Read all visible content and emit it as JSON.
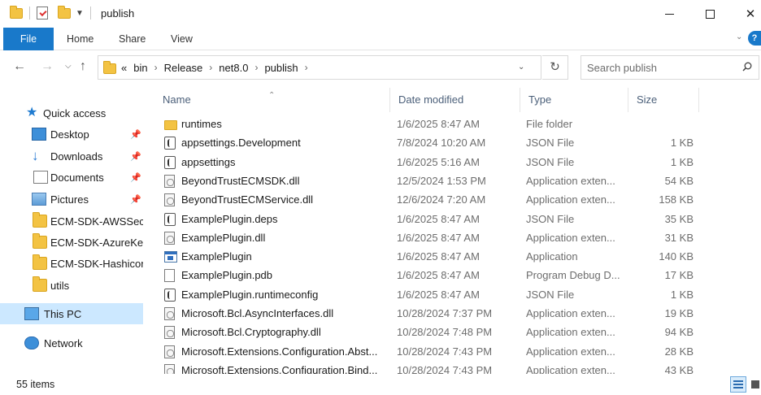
{
  "window": {
    "title": "publish"
  },
  "ribbon": {
    "tabs": [
      "File",
      "Home",
      "Share",
      "View"
    ]
  },
  "address": {
    "overflow": "«",
    "crumbs": [
      "bin",
      "Release",
      "net8.0",
      "publish"
    ]
  },
  "search": {
    "placeholder": "Search publish"
  },
  "nav_pane": {
    "items": [
      {
        "label": "Quick access",
        "icon": "star-icon"
      },
      {
        "label": "Desktop",
        "icon": "desktop-icon",
        "pinned": true
      },
      {
        "label": "Downloads",
        "icon": "download-icon",
        "pinned": true
      },
      {
        "label": "Documents",
        "icon": "documents-icon",
        "pinned": true
      },
      {
        "label": "Pictures",
        "icon": "pictures-icon",
        "pinned": true
      },
      {
        "label": "ECM-SDK-AWSSecr",
        "icon": "folder-icon"
      },
      {
        "label": "ECM-SDK-AzureKey",
        "icon": "folder-icon"
      },
      {
        "label": "ECM-SDK-Hashicor",
        "icon": "folder-icon"
      },
      {
        "label": "utils",
        "icon": "folder-icon"
      },
      {
        "label": "This PC",
        "icon": "this-pc-icon",
        "selected": true
      },
      {
        "label": "Network",
        "icon": "network-icon"
      }
    ]
  },
  "columns": {
    "name": "Name",
    "date": "Date modified",
    "type": "Type",
    "size": "Size"
  },
  "files": [
    {
      "name": "runtimes",
      "date": "1/6/2025 8:47 AM",
      "type": "File folder",
      "size": "",
      "icon": "folder"
    },
    {
      "name": "appsettings.Development",
      "date": "7/8/2024 10:20 AM",
      "type": "JSON File",
      "size": "1 KB",
      "icon": "json"
    },
    {
      "name": "appsettings",
      "date": "1/6/2025 5:16 AM",
      "type": "JSON File",
      "size": "1 KB",
      "icon": "json"
    },
    {
      "name": "BeyondTrustECMSDK.dll",
      "date": "12/5/2024 1:53 PM",
      "type": "Application exten...",
      "size": "54 KB",
      "icon": "dll"
    },
    {
      "name": "BeyondTrustECMService.dll",
      "date": "12/6/2024 7:20 AM",
      "type": "Application exten...",
      "size": "158 KB",
      "icon": "dll"
    },
    {
      "name": "ExamplePlugin.deps",
      "date": "1/6/2025 8:47 AM",
      "type": "JSON File",
      "size": "35 KB",
      "icon": "json"
    },
    {
      "name": "ExamplePlugin.dll",
      "date": "1/6/2025 8:47 AM",
      "type": "Application exten...",
      "size": "31 KB",
      "icon": "dll"
    },
    {
      "name": "ExamplePlugin",
      "date": "1/6/2025 8:47 AM",
      "type": "Application",
      "size": "140 KB",
      "icon": "app"
    },
    {
      "name": "ExamplePlugin.pdb",
      "date": "1/6/2025 8:47 AM",
      "type": "Program Debug D...",
      "size": "17 KB",
      "icon": "blank"
    },
    {
      "name": "ExamplePlugin.runtimeconfig",
      "date": "1/6/2025 8:47 AM",
      "type": "JSON File",
      "size": "1 KB",
      "icon": "json"
    },
    {
      "name": "Microsoft.Bcl.AsyncInterfaces.dll",
      "date": "10/28/2024 7:37 PM",
      "type": "Application exten...",
      "size": "19 KB",
      "icon": "dll"
    },
    {
      "name": "Microsoft.Bcl.Cryptography.dll",
      "date": "10/28/2024 7:48 PM",
      "type": "Application exten...",
      "size": "94 KB",
      "icon": "dll"
    },
    {
      "name": "Microsoft.Extensions.Configuration.Abst...",
      "date": "10/28/2024 7:43 PM",
      "type": "Application exten...",
      "size": "28 KB",
      "icon": "dll"
    },
    {
      "name": "Microsoft.Extensions.Configuration.Bind...",
      "date": "10/28/2024 7:43 PM",
      "type": "Application exten...",
      "size": "43 KB",
      "icon": "dll"
    }
  ],
  "status": {
    "item_count": "55 items"
  }
}
